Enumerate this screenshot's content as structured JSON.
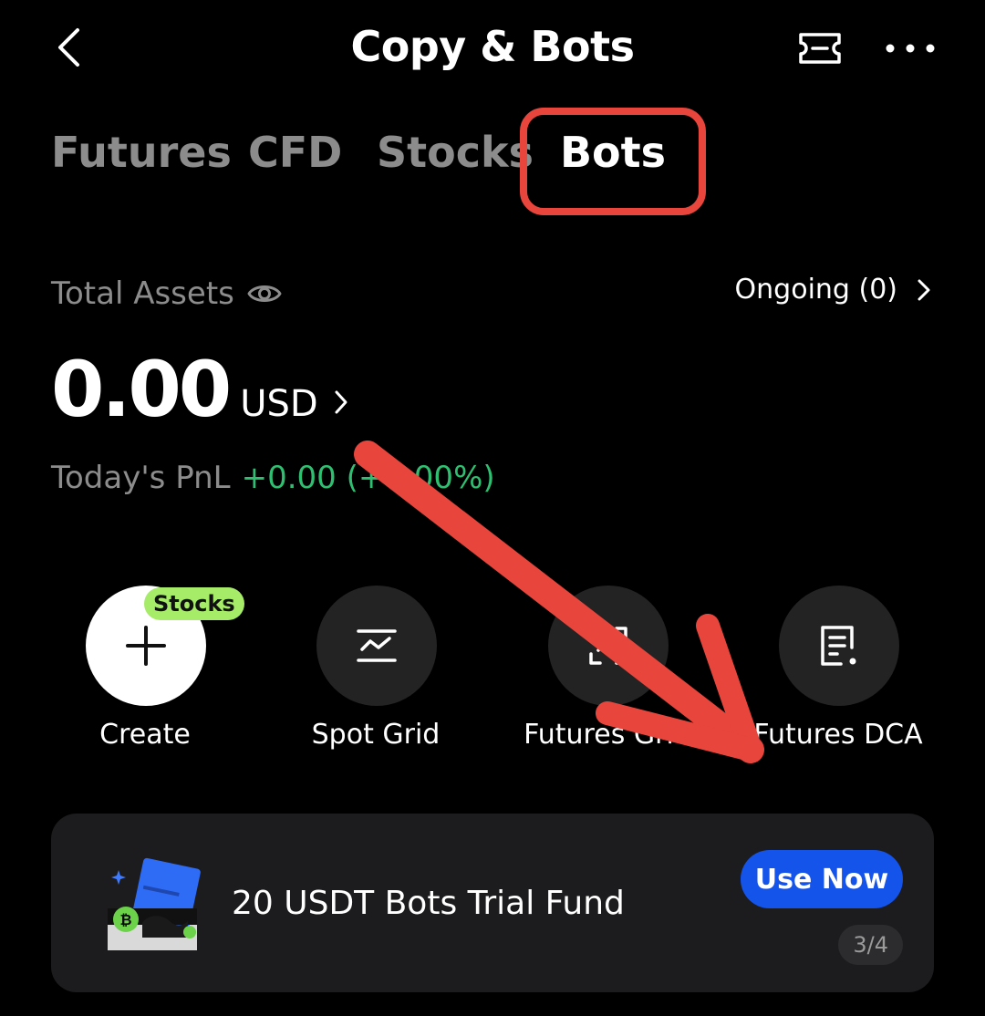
{
  "header": {
    "title": "Copy & Bots",
    "back_icon": "chevron-left-icon",
    "ticket_icon": "ticket-icon",
    "more_icon": "more-horizontal-icon"
  },
  "tabs": [
    {
      "label": "Futures",
      "active": false
    },
    {
      "label": "CFD",
      "active": false
    },
    {
      "label": "Stocks",
      "active": false
    },
    {
      "label": "Bots",
      "active": true
    }
  ],
  "assets": {
    "label": "Total Assets",
    "visibility_icon": "eye-icon",
    "ongoing_label": "Ongoing (0)",
    "total_value": "0.00",
    "currency": "USD",
    "pnl_label": "Today's PnL",
    "pnl_value": "+0.00 (+0.00%)"
  },
  "shortcuts": [
    {
      "label": "Create",
      "icon": "plus-icon",
      "badge": "Stocks"
    },
    {
      "label": "Spot Grid",
      "icon": "spot-grid-icon"
    },
    {
      "label": "Futures Grid",
      "icon": "futures-grid-icon"
    },
    {
      "label": "Futures DCA",
      "icon": "futures-dca-icon"
    }
  ],
  "promo": {
    "title": "20 USDT Bots Trial Fund",
    "button_label": "Use Now",
    "pager": "3/4",
    "illustration": "bitcoin-ticket-icon"
  },
  "colors": {
    "background": "#000000",
    "accent_blue": "#1554ea",
    "pnl_green": "#2fbf71",
    "badge_green": "#a6ec68",
    "annotation_red": "#e8453c"
  }
}
